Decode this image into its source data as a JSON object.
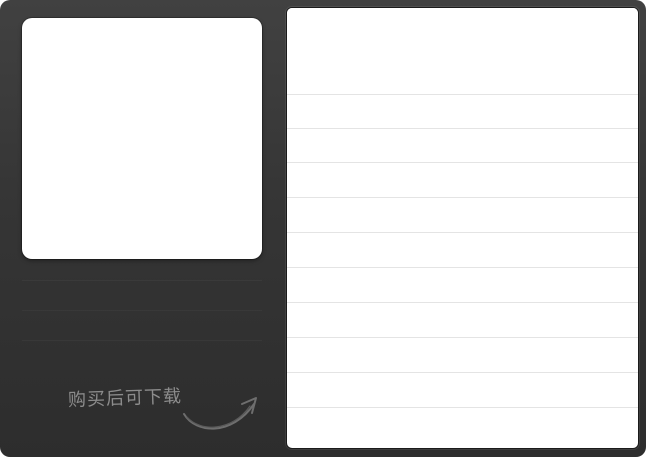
{
  "note": {
    "text": "购买后可下载"
  },
  "icons": {
    "curved_arrow": "curved-arrow-icon"
  },
  "colors": {
    "frame_top": "#414141",
    "frame_bottom": "#2d2d2d",
    "note_text": "#8c8c8c",
    "panel_background": "#ffffff",
    "panel_rule": "#e4e4e4"
  }
}
